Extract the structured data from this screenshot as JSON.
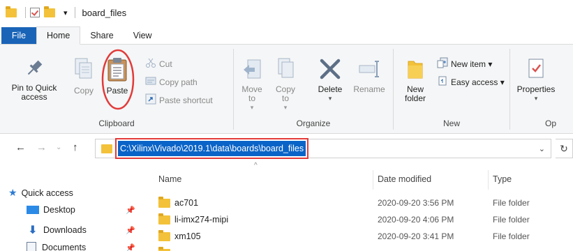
{
  "window": {
    "title": "board_files",
    "qa_dropdown": "▾"
  },
  "tabs": [
    {
      "label": "File"
    },
    {
      "label": "Home"
    },
    {
      "label": "Share"
    },
    {
      "label": "View"
    }
  ],
  "ribbon": {
    "clipboard": {
      "label": "Clipboard",
      "pin_label": "Pin to Quick access",
      "copy_label": "Copy",
      "paste_label": "Paste",
      "cut_label": "Cut",
      "copy_path_label": "Copy path",
      "paste_shortcut_label": "Paste shortcut"
    },
    "organize": {
      "label": "Organize",
      "move_label": "Move to",
      "copy_to_label": "Copy to",
      "delete_label": "Delete",
      "rename_label": "Rename"
    },
    "new": {
      "label": "New",
      "new_folder_label": "New folder",
      "new_item_label": "New item ▾",
      "easy_access_label": "Easy access ▾"
    },
    "open": {
      "label": "Op",
      "properties_label": "Properties"
    }
  },
  "address": {
    "path": "C:\\Xilinx\\Vivado\\2019.1\\data\\boards\\board_files"
  },
  "nav_pane": {
    "items": [
      {
        "label": "Quick access"
      },
      {
        "label": "Desktop"
      },
      {
        "label": "Downloads"
      },
      {
        "label": "Documents"
      }
    ]
  },
  "file_list": {
    "columns": {
      "name": "Name",
      "date": "Date modified",
      "type": "Type"
    },
    "rows": [
      {
        "name": "ac701",
        "date": "2020-09-20 3:56 PM",
        "type": "File folder"
      },
      {
        "name": "li-imx274-mipi",
        "date": "2020-09-20 4:06 PM",
        "type": "File folder"
      },
      {
        "name": "xm105",
        "date": "2020-09-20 3:41 PM",
        "type": "File folder"
      }
    ]
  },
  "colors": {
    "accent": "#1a64b8",
    "selection": "#0a64c8",
    "highlight_annotation": "#e23a3a",
    "folder": "#f3c23a"
  }
}
